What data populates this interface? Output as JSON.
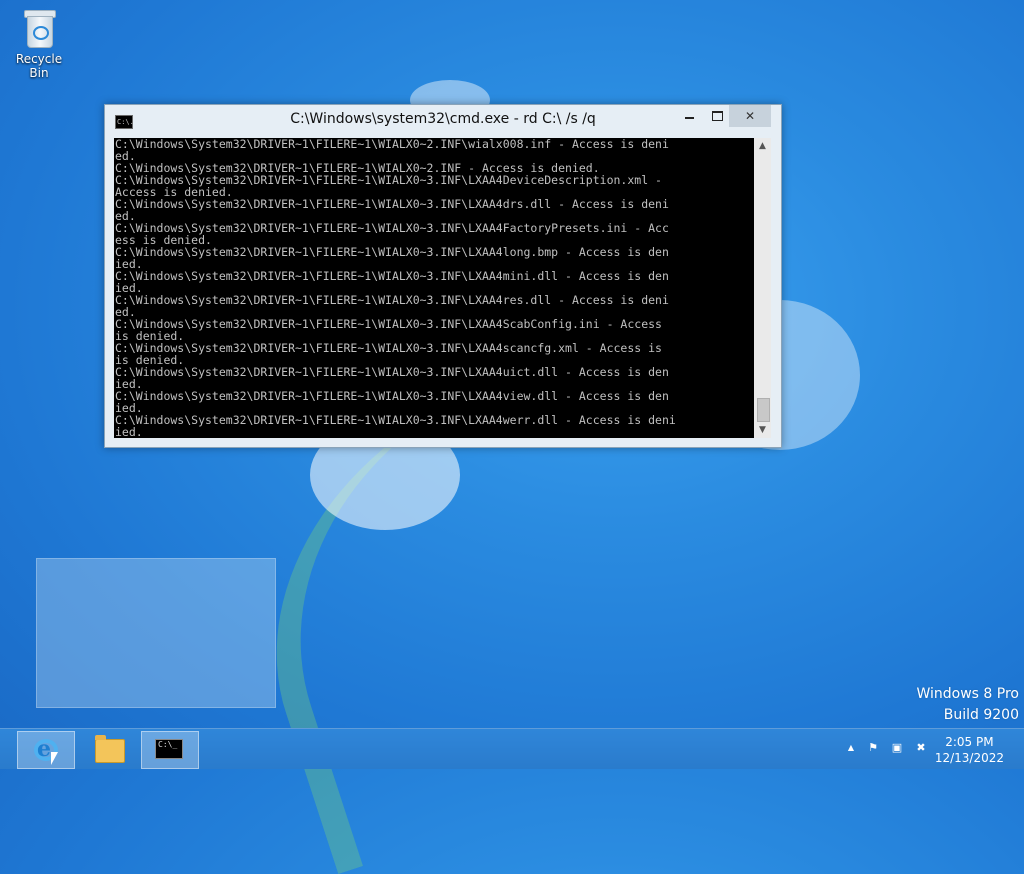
{
  "desktop": {
    "recycle_bin_label": "Recycle Bin",
    "watermark": {
      "line1": "Windows 8 Pro",
      "line2": "Build 9200"
    }
  },
  "cmd_window": {
    "title": "C:\\Windows\\system32\\cmd.exe - rd  C:\\ /s /q",
    "icon_text": "C:\\.",
    "close_glyph": "✕",
    "console_lines": [
      "C:\\Windows\\System32\\DRIVER~1\\FILERE~1\\WIALX0~2.INF\\wialx008.inf - Access is deni",
      "ed.",
      "C:\\Windows\\System32\\DRIVER~1\\FILERE~1\\WIALX0~2.INF - Access is denied.",
      "C:\\Windows\\System32\\DRIVER~1\\FILERE~1\\WIALX0~3.INF\\LXAA4DeviceDescription.xml -",
      "Access is denied.",
      "C:\\Windows\\System32\\DRIVER~1\\FILERE~1\\WIALX0~3.INF\\LXAA4drs.dll - Access is deni",
      "ed.",
      "C:\\Windows\\System32\\DRIVER~1\\FILERE~1\\WIALX0~3.INF\\LXAA4FactoryPresets.ini - Acc",
      "ess is denied.",
      "C:\\Windows\\System32\\DRIVER~1\\FILERE~1\\WIALX0~3.INF\\LXAA4long.bmp - Access is den",
      "ied.",
      "C:\\Windows\\System32\\DRIVER~1\\FILERE~1\\WIALX0~3.INF\\LXAA4mini.dll - Access is den",
      "ied.",
      "C:\\Windows\\System32\\DRIVER~1\\FILERE~1\\WIALX0~3.INF\\LXAA4res.dll - Access is deni",
      "ed.",
      "C:\\Windows\\System32\\DRIVER~1\\FILERE~1\\WIALX0~3.INF\\LXAA4ScabConfig.ini - Access",
      "is denied.",
      "C:\\Windows\\System32\\DRIVER~1\\FILERE~1\\WIALX0~3.INF\\LXAA4scancfg.xml - Access is",
      "is denied.",
      "C:\\Windows\\System32\\DRIVER~1\\FILERE~1\\WIALX0~3.INF\\LXAA4uict.dll - Access is den",
      "ied.",
      "C:\\Windows\\System32\\DRIVER~1\\FILERE~1\\WIALX0~3.INF\\LXAA4view.dll - Access is den",
      "ied.",
      "C:\\Windows\\System32\\DRIVER~1\\FILERE~1\\WIALX0~3.INF\\LXAA4werr.dll - Access is deni",
      "ied."
    ]
  },
  "taskbar": {
    "buttons": [
      {
        "name": "internet-explorer",
        "icon": "ie-icon",
        "active": true
      },
      {
        "name": "file-explorer",
        "icon": "folder-icon",
        "active": false
      },
      {
        "name": "command-prompt",
        "icon": "terminal-icon",
        "active": true
      }
    ],
    "terminal_icon_text": "C:\\_",
    "tray": {
      "show_hidden_glyph": "▲",
      "icons": [
        "flag-icon",
        "network-icon",
        "volume-muted-icon"
      ],
      "time": "2:05 PM",
      "date": "12/13/2022"
    }
  }
}
